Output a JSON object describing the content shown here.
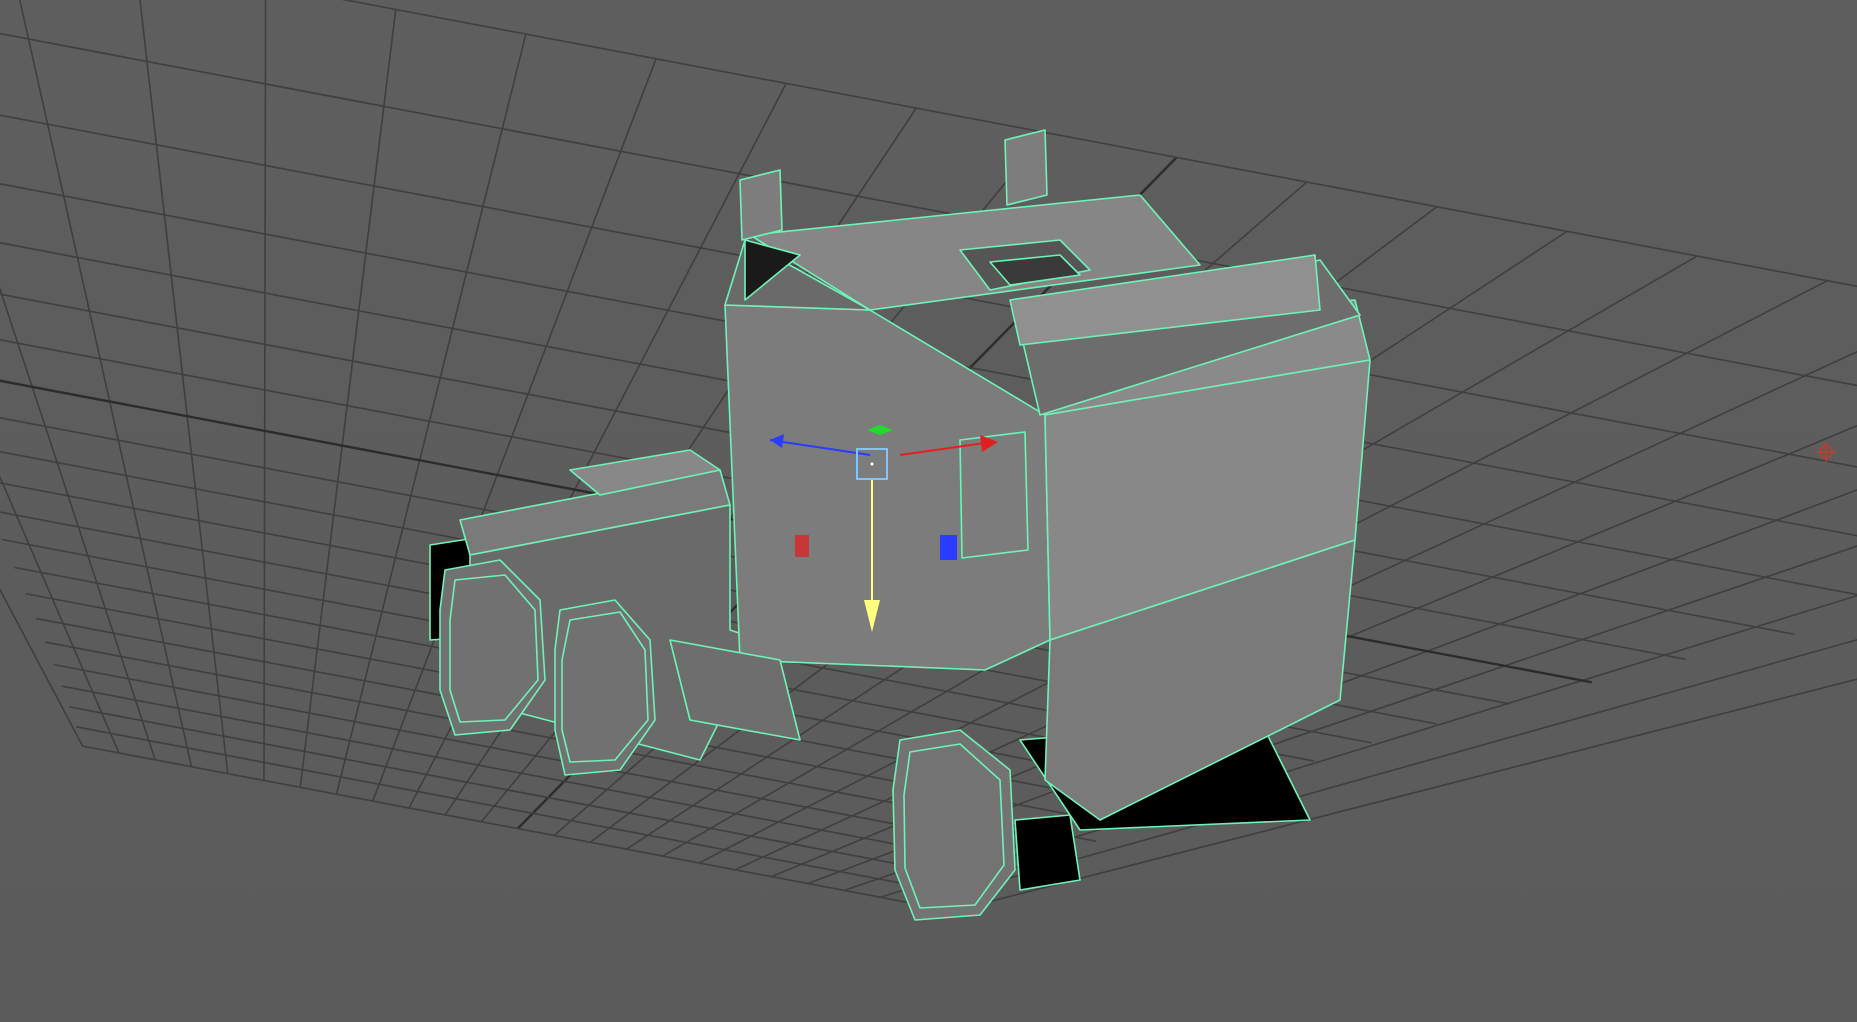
{
  "viewport": {
    "background_color": "#5d5d5d",
    "grid_color": "#3f3f3f",
    "grid_axis_color": "#2c2c2c",
    "wireframe_color": "#6ff2b8",
    "surface_light": "#8a8a8a",
    "surface_mid": "#7a7a7a",
    "surface_dark": "#6c6c6c",
    "shadow_color": "#000000",
    "model": "truck-cab-polygon-mesh",
    "selection_state": "selected"
  },
  "gizmo": {
    "type": "move-manipulator",
    "x_axis_color": "#e02020",
    "y_axis_color": "#ffff80",
    "z_axis_color": "#2a3cff",
    "center_color": "#7fc4ff",
    "plane_handle_green": "#1fdc2a",
    "plane_handle_red": "#e02020",
    "plane_handle_blue": "#2a3cff"
  },
  "pivot_marker": {
    "icon": "crosshair-icon",
    "color": "#c23c2c"
  }
}
